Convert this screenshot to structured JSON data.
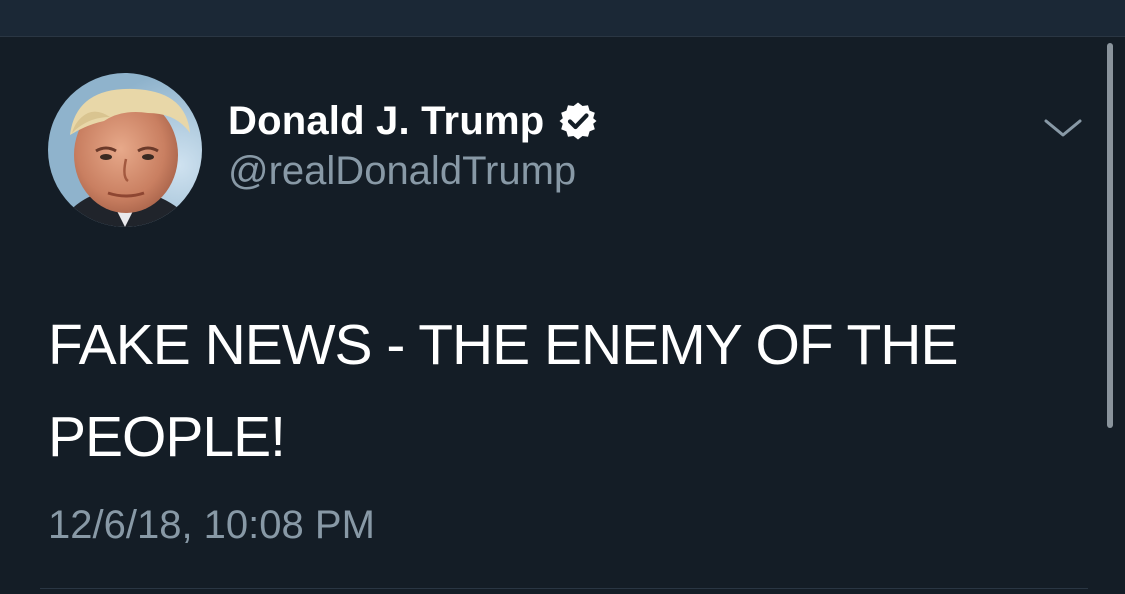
{
  "tweet": {
    "author": {
      "display_name": "Donald J. Trump",
      "handle": "@realDonaldTrump",
      "verified_icon": "verified-badge-icon",
      "avatar_icon": "profile-photo"
    },
    "menu_icon": "chevron-down-icon",
    "text": "FAKE NEWS - THE ENEMY OF THE PEOPLE!",
    "timestamp": "12/6/18, 10:08 PM"
  },
  "colors": {
    "background": "#141d26",
    "top_bar": "#1b2836",
    "primary_text": "#ffffff",
    "secondary_text": "#8899a6",
    "divider": "#2a3643",
    "scrollbar": "#8a949c"
  }
}
